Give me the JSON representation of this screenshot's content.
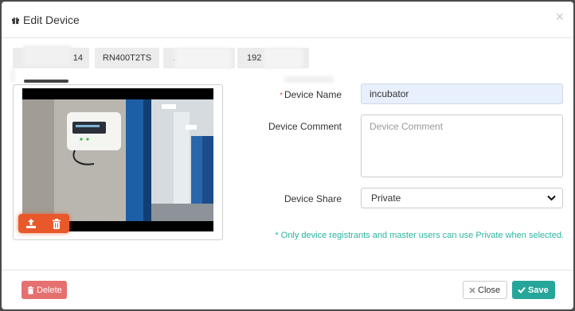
{
  "modal": {
    "title": "Edit Device",
    "title_icon": "gift-icon",
    "close_glyph": "×"
  },
  "tags": [
    {
      "text": "14"
    },
    {
      "text": "RN400T2TS"
    },
    {
      "text": "."
    },
    {
      "text": "192"
    }
  ],
  "image_panel": {
    "upload_icon": "upload-icon",
    "trash_icon": "trash-icon",
    "toolbar_color": "#e8582a"
  },
  "form": {
    "device_name_label": "Device Name",
    "device_name_required": "*",
    "device_name_value": "incubator",
    "device_comment_label": "Device Comment",
    "device_comment_placeholder": "Device Comment",
    "device_share_label": "Device Share",
    "device_share_value": "Private",
    "note": "* Only device registrants and master users can use Private when selected."
  },
  "footer": {
    "delete_label": "Delete",
    "close_label": "Close",
    "save_label": "Save"
  },
  "colors": {
    "accent": "#26a69a",
    "danger": "#e47170",
    "note": "#2bb5a0"
  }
}
